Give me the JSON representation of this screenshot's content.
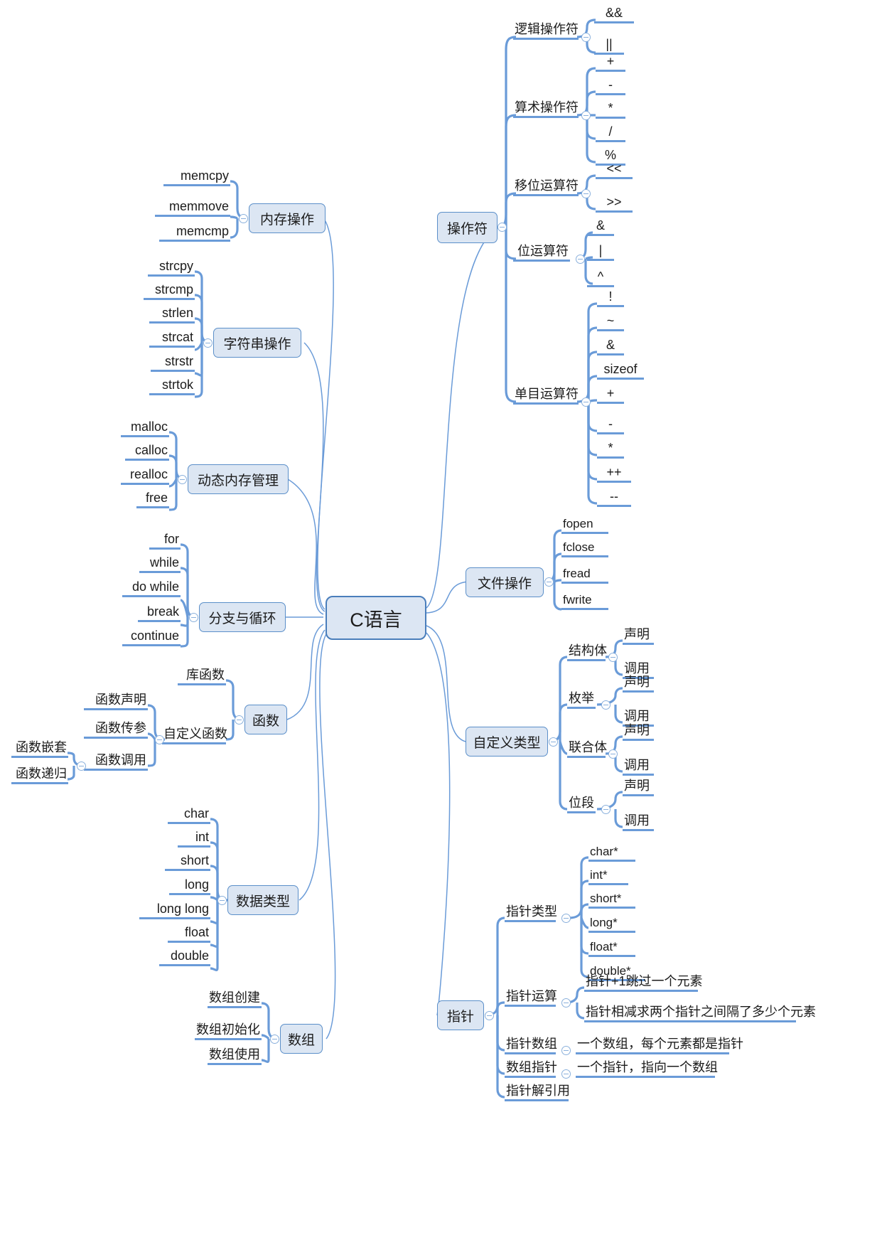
{
  "diagram": {
    "title": "C语言",
    "type": "mindmap",
    "colors": {
      "node_fill": "#dce6f3",
      "node_border": "#4a7ebb",
      "branch_line": "#6a9bd8",
      "text": "#1b1b1b",
      "background": "#ffffff"
    }
  },
  "root": {
    "label": "C语言"
  },
  "branches": {
    "memory_ops": {
      "label": "内存操作",
      "children": [
        "memcpy",
        "memmove",
        "memcmp"
      ]
    },
    "string_ops": {
      "label": "字符串操作",
      "children": [
        "strcpy",
        "strcmp",
        "strlen",
        "strcat",
        "strstr",
        "strtok"
      ]
    },
    "dynamic_memory": {
      "label": "动态内存管理",
      "children": [
        "malloc",
        "calloc",
        "realloc",
        "free"
      ]
    },
    "branch_loop": {
      "label": "分支与循环",
      "children": [
        "for",
        "while",
        "do while",
        "break",
        "continue"
      ]
    },
    "functions": {
      "label": "函数",
      "children": [
        {
          "label": "库函数",
          "children": []
        },
        {
          "label": "自定义函数",
          "children": [
            {
              "label": "函数声明",
              "children": []
            },
            {
              "label": "函数传参",
              "children": []
            },
            {
              "label": "函数调用",
              "children": [
                "函数嵌套",
                "函数递归"
              ]
            }
          ]
        }
      ]
    },
    "data_types": {
      "label": "数据类型",
      "children": [
        "char",
        "int",
        "short",
        "long",
        "long long",
        "float",
        "double"
      ]
    },
    "arrays": {
      "label": "数组",
      "children": [
        "数组创建",
        "数组初始化",
        "数组使用"
      ]
    },
    "operators": {
      "label": "操作符",
      "children": [
        {
          "label": "逻辑操作符",
          "children": [
            "&&",
            "||"
          ]
        },
        {
          "label": "算术操作符",
          "children": [
            "+",
            "-",
            "*",
            "/",
            "%"
          ]
        },
        {
          "label": "移位运算符",
          "children": [
            "<<",
            ">>"
          ]
        },
        {
          "label": "位运算符",
          "children": [
            "&",
            "|",
            "^"
          ]
        },
        {
          "label": "单目运算符",
          "children": [
            "!",
            "~",
            "&",
            "sizeof",
            "+",
            "-",
            "*",
            "++",
            "--"
          ]
        }
      ]
    },
    "file_ops": {
      "label": "文件操作",
      "children": [
        "fopen",
        "fclose",
        "fread",
        "fwrite"
      ]
    },
    "custom_types": {
      "label": "自定义类型",
      "children": [
        {
          "label": "结构体",
          "children": [
            "声明",
            "调用"
          ]
        },
        {
          "label": "枚举",
          "children": [
            "声明",
            "调用"
          ]
        },
        {
          "label": "联合体",
          "children": [
            "声明",
            "调用"
          ]
        },
        {
          "label": "位段",
          "children": [
            "声明",
            "调用"
          ]
        }
      ]
    },
    "pointers": {
      "label": "指针",
      "children": [
        {
          "label": "指针类型",
          "children": [
            "char*",
            "int*",
            "short*",
            "long*",
            "float*",
            "double*"
          ]
        },
        {
          "label": "指针运算",
          "children": [
            "指针+1跳过一个元素",
            "指针相减求两个指针之间隔了多少个元素"
          ]
        },
        {
          "label": "指针数组",
          "children": [
            "一个数组，每个元素都是指针"
          ]
        },
        {
          "label": "数组指针",
          "children": [
            "一个指针，指向一个数组"
          ]
        },
        {
          "label": "指针解引用",
          "children": []
        }
      ]
    }
  }
}
